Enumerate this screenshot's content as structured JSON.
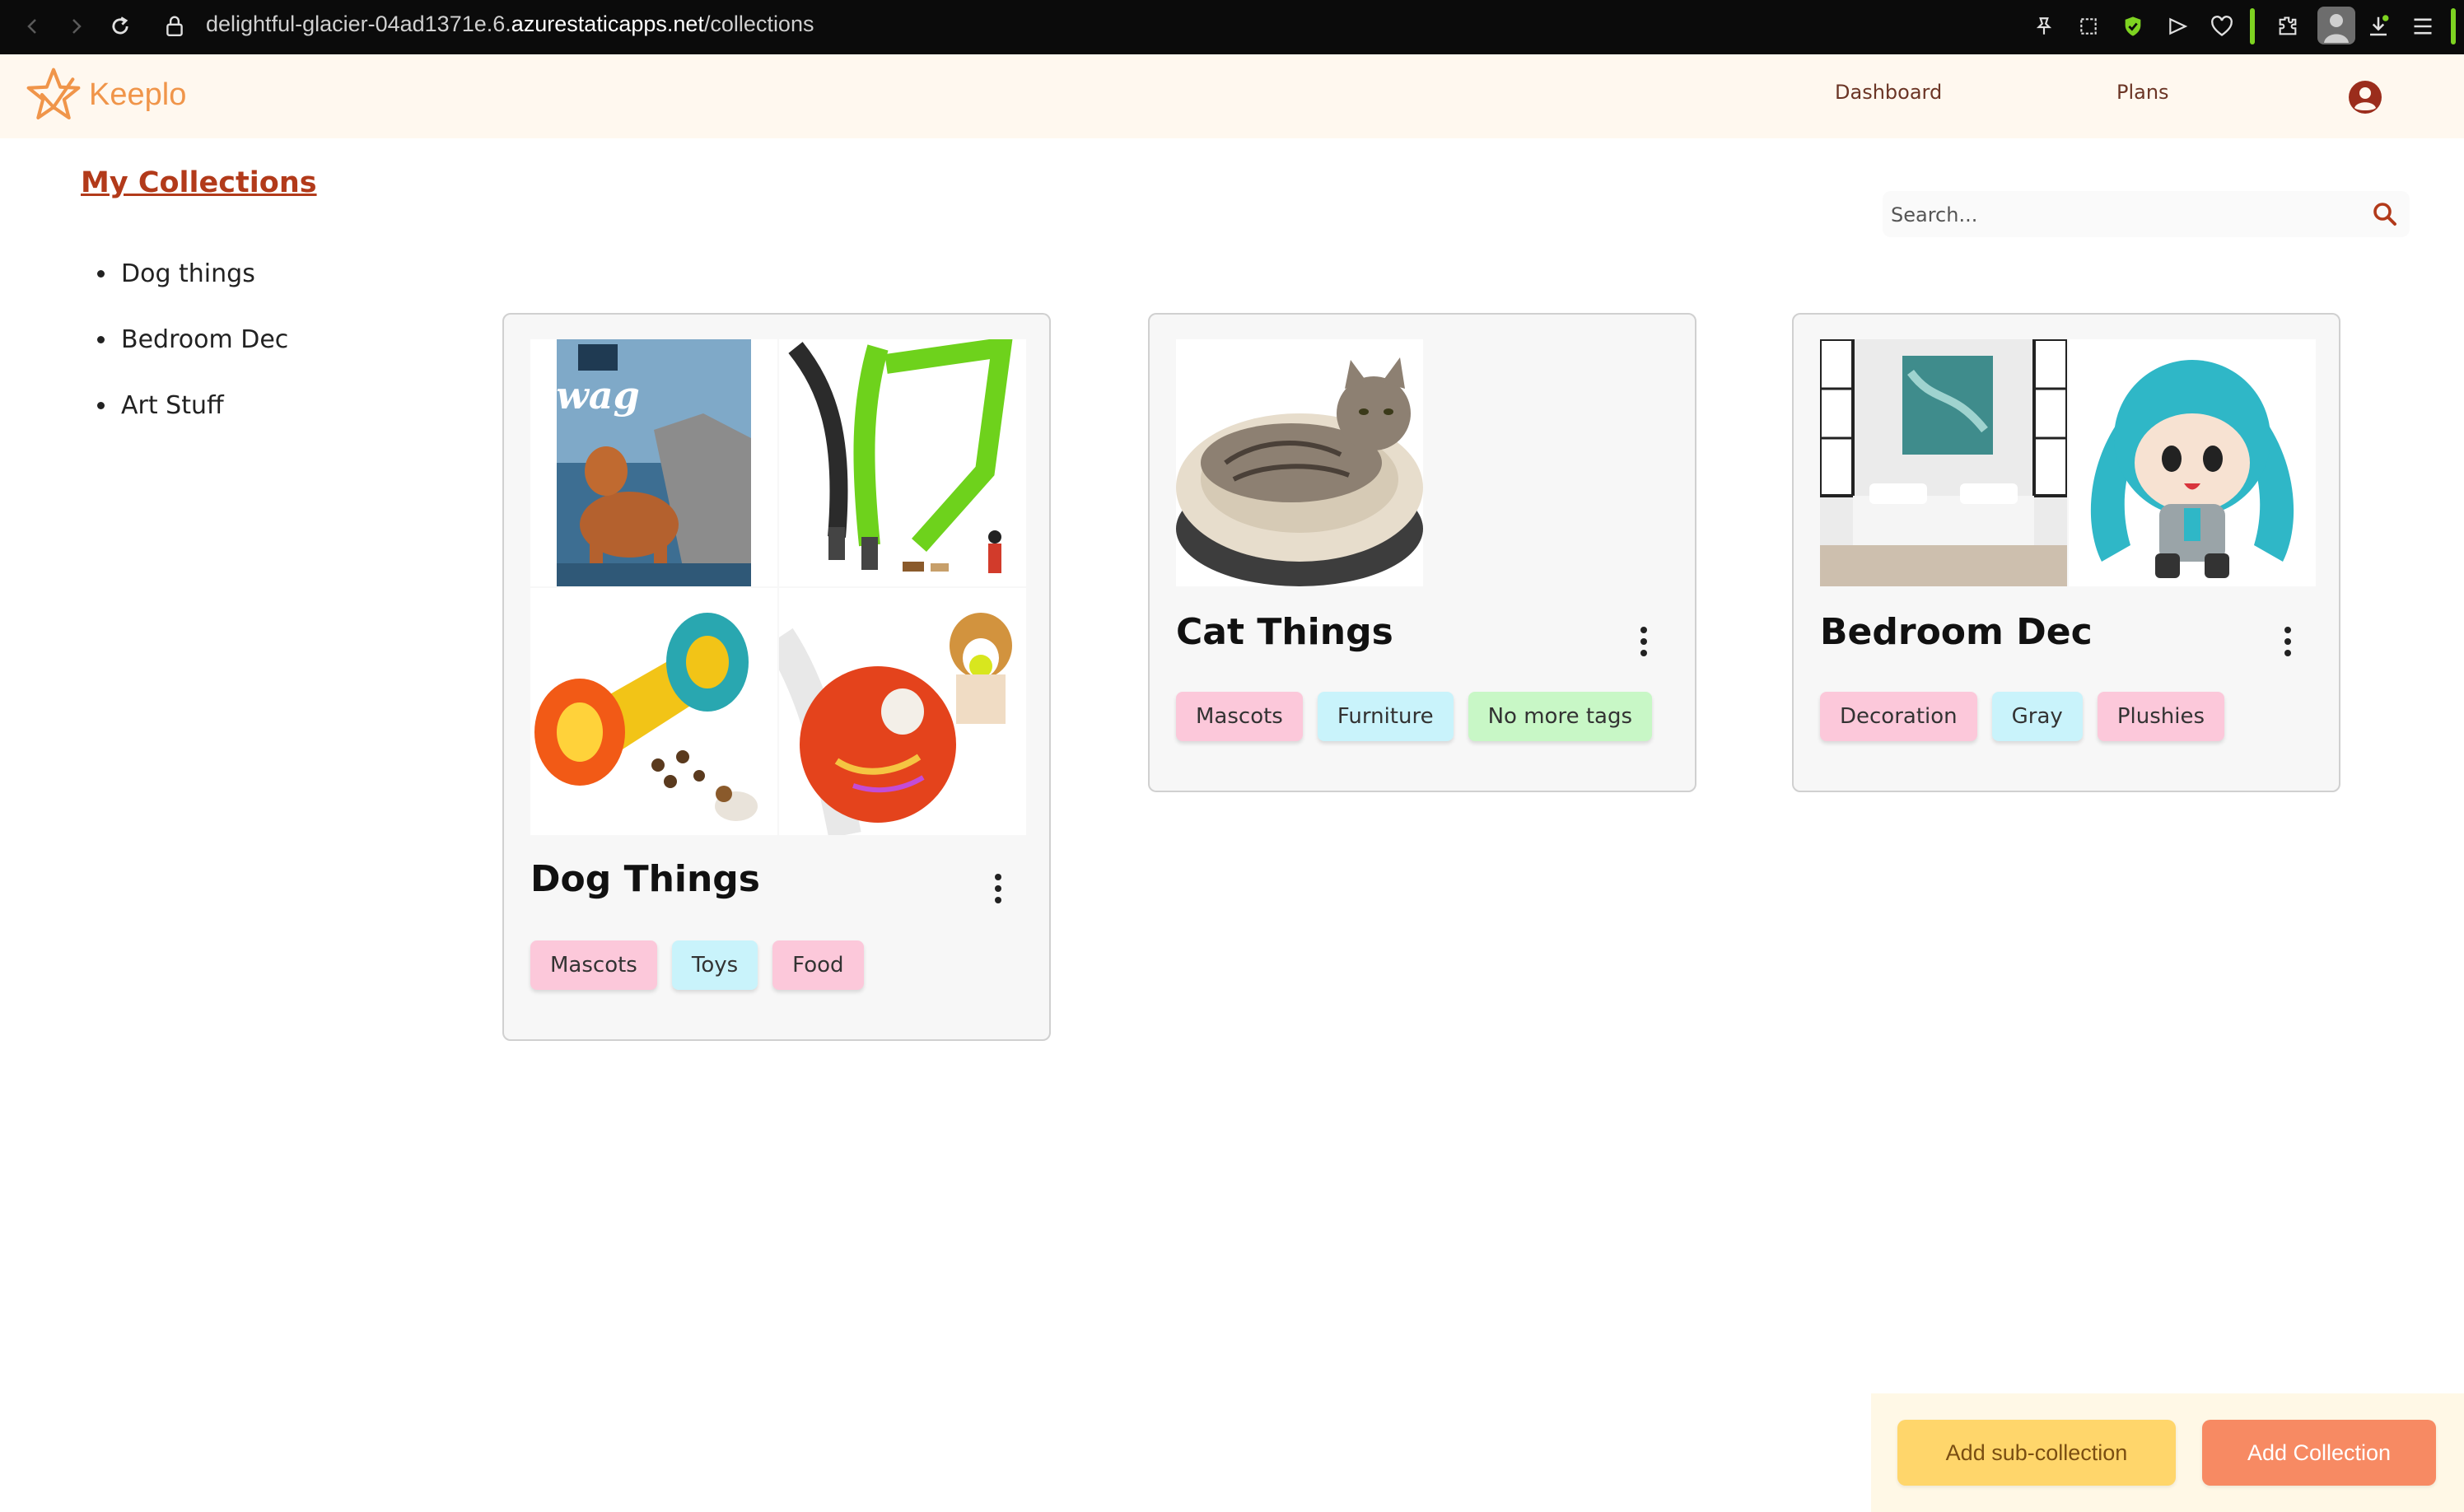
{
  "browser": {
    "url_prefix": "delightful-glacier-04ad1371e.6.",
    "url_domain": "azurestaticapps.net",
    "url_path": "/collections"
  },
  "app": {
    "brand": "Keeplo",
    "nav": {
      "dashboard": "Dashboard",
      "plans": "Plans"
    }
  },
  "sidebar": {
    "title": "My Collections",
    "items": [
      {
        "label": "Dog things"
      },
      {
        "label": "Bedroom Dec"
      },
      {
        "label": "Art Stuff"
      }
    ]
  },
  "search": {
    "placeholder": "Search..."
  },
  "cards": [
    {
      "title": "Dog Things",
      "images": [
        "dog-food-bag",
        "green-leash",
        "treat-dispenser-toy",
        "orange-ball-toy"
      ],
      "tags": [
        {
          "label": "Mascots",
          "color": "#fcc8da"
        },
        {
          "label": "Toys",
          "color": "#c9f3fb"
        },
        {
          "label": "Food",
          "color": "#fcc8da"
        }
      ]
    },
    {
      "title": "Cat Things",
      "images": [
        "cat-in-bed"
      ],
      "tags": [
        {
          "label": "Mascots",
          "color": "#fcc8da"
        },
        {
          "label": "Furniture",
          "color": "#c9f3fb"
        },
        {
          "label": "No more tags",
          "color": "#c8f7c6"
        }
      ]
    },
    {
      "title": "Bedroom Dec",
      "images": [
        "bedroom-interior",
        "miku-plush"
      ],
      "tags": [
        {
          "label": "Decoration",
          "color": "#fcc8da"
        },
        {
          "label": "Gray",
          "color": "#c9f3fb"
        },
        {
          "label": "Plushies",
          "color": "#fcc8da"
        }
      ]
    }
  ],
  "actions": {
    "add_sub": "Add sub-collection",
    "add_collection": "Add Collection"
  },
  "colors": {
    "accent": "#b23a1a",
    "header_bg": "#fff8ef",
    "add_sub_bg": "#ffd66b",
    "add_collection_bg": "#f78a63"
  }
}
